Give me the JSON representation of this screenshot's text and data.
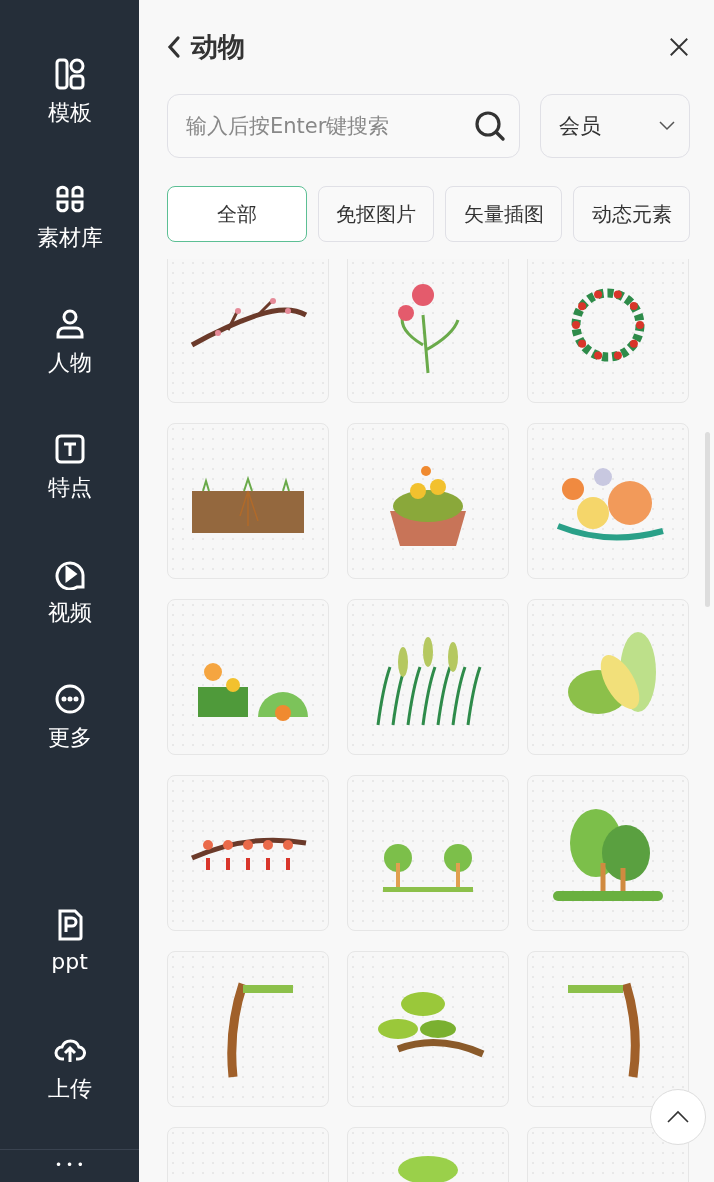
{
  "sidebar": {
    "items": [
      {
        "label": "模板"
      },
      {
        "label": "素材库"
      },
      {
        "label": "人物"
      },
      {
        "label": "特点"
      },
      {
        "label": "视频"
      },
      {
        "label": "更多"
      }
    ],
    "bottom_items": [
      {
        "label": "ppt"
      },
      {
        "label": "上传"
      }
    ],
    "more": "• • •"
  },
  "panel": {
    "title": "动物",
    "search": {
      "placeholder": "输入后按Enter键搜索"
    },
    "dropdown": {
      "value": "会员"
    },
    "chips": [
      {
        "label": "全部",
        "selected": true
      },
      {
        "label": "免抠图片",
        "selected": false
      },
      {
        "label": "矢量插图",
        "selected": false
      },
      {
        "label": "动态元素",
        "selected": false
      }
    ]
  }
}
